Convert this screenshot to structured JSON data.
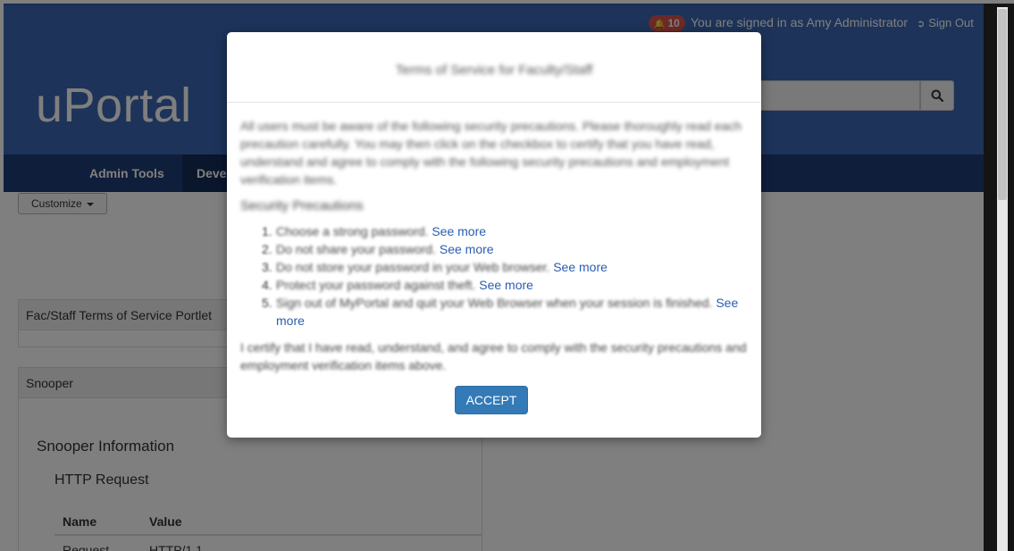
{
  "topbar": {
    "notification_count": "10",
    "signed_in_text": "You are signed in as Amy Administrator",
    "sign_out_label": "Sign Out"
  },
  "header": {
    "logo": "uPortal"
  },
  "nav": {
    "items": [
      {
        "label": "Admin Tools"
      },
      {
        "label": "Deve"
      }
    ]
  },
  "customize_label": "Customize",
  "portlets": {
    "fac_staff_title": "Fac/Staff Terms of Service Portlet",
    "snooper_title": "Snooper",
    "snooper_heading": "Snooper Information",
    "http_heading": "HTTP Request",
    "table_headers": [
      "Name",
      "Value"
    ],
    "table_rows": [
      [
        "Request",
        "HTTP/1.1"
      ]
    ]
  },
  "modal": {
    "title": "Terms of Service for Faculty/Staff",
    "intro": "All users must be aware of the following security precautions. Please thoroughly read each precaution carefully. You may then click on the checkbox to certify that you have read, understand and agree to comply with the following security precautions and employment verification items.",
    "section_title": "Security Precautions",
    "rules": [
      {
        "num": "1.",
        "text": "Choose a strong password.",
        "link": "See more"
      },
      {
        "num": "2.",
        "text": "Do not share your password.",
        "link": "See more"
      },
      {
        "num": "3.",
        "text": "Do not store your password in your Web browser.",
        "link": "See more"
      },
      {
        "num": "4.",
        "text": "Protect your password against theft.",
        "link": "See more"
      },
      {
        "num": "5.",
        "text": "Sign out of MyPortal and quit your Web Browser when your session is finished.",
        "link": "See more"
      }
    ],
    "certify_text": "I certify that I have read, understand, and agree to comply with the security precautions and employment verification items above.",
    "accept_label": "ACCEPT"
  },
  "colors": {
    "header_blue": "#3a67b2",
    "nav_dark": "#1f3e77",
    "accept_blue": "#337ab7",
    "link_blue": "#2a5db0",
    "badge_red": "#d9534f"
  }
}
